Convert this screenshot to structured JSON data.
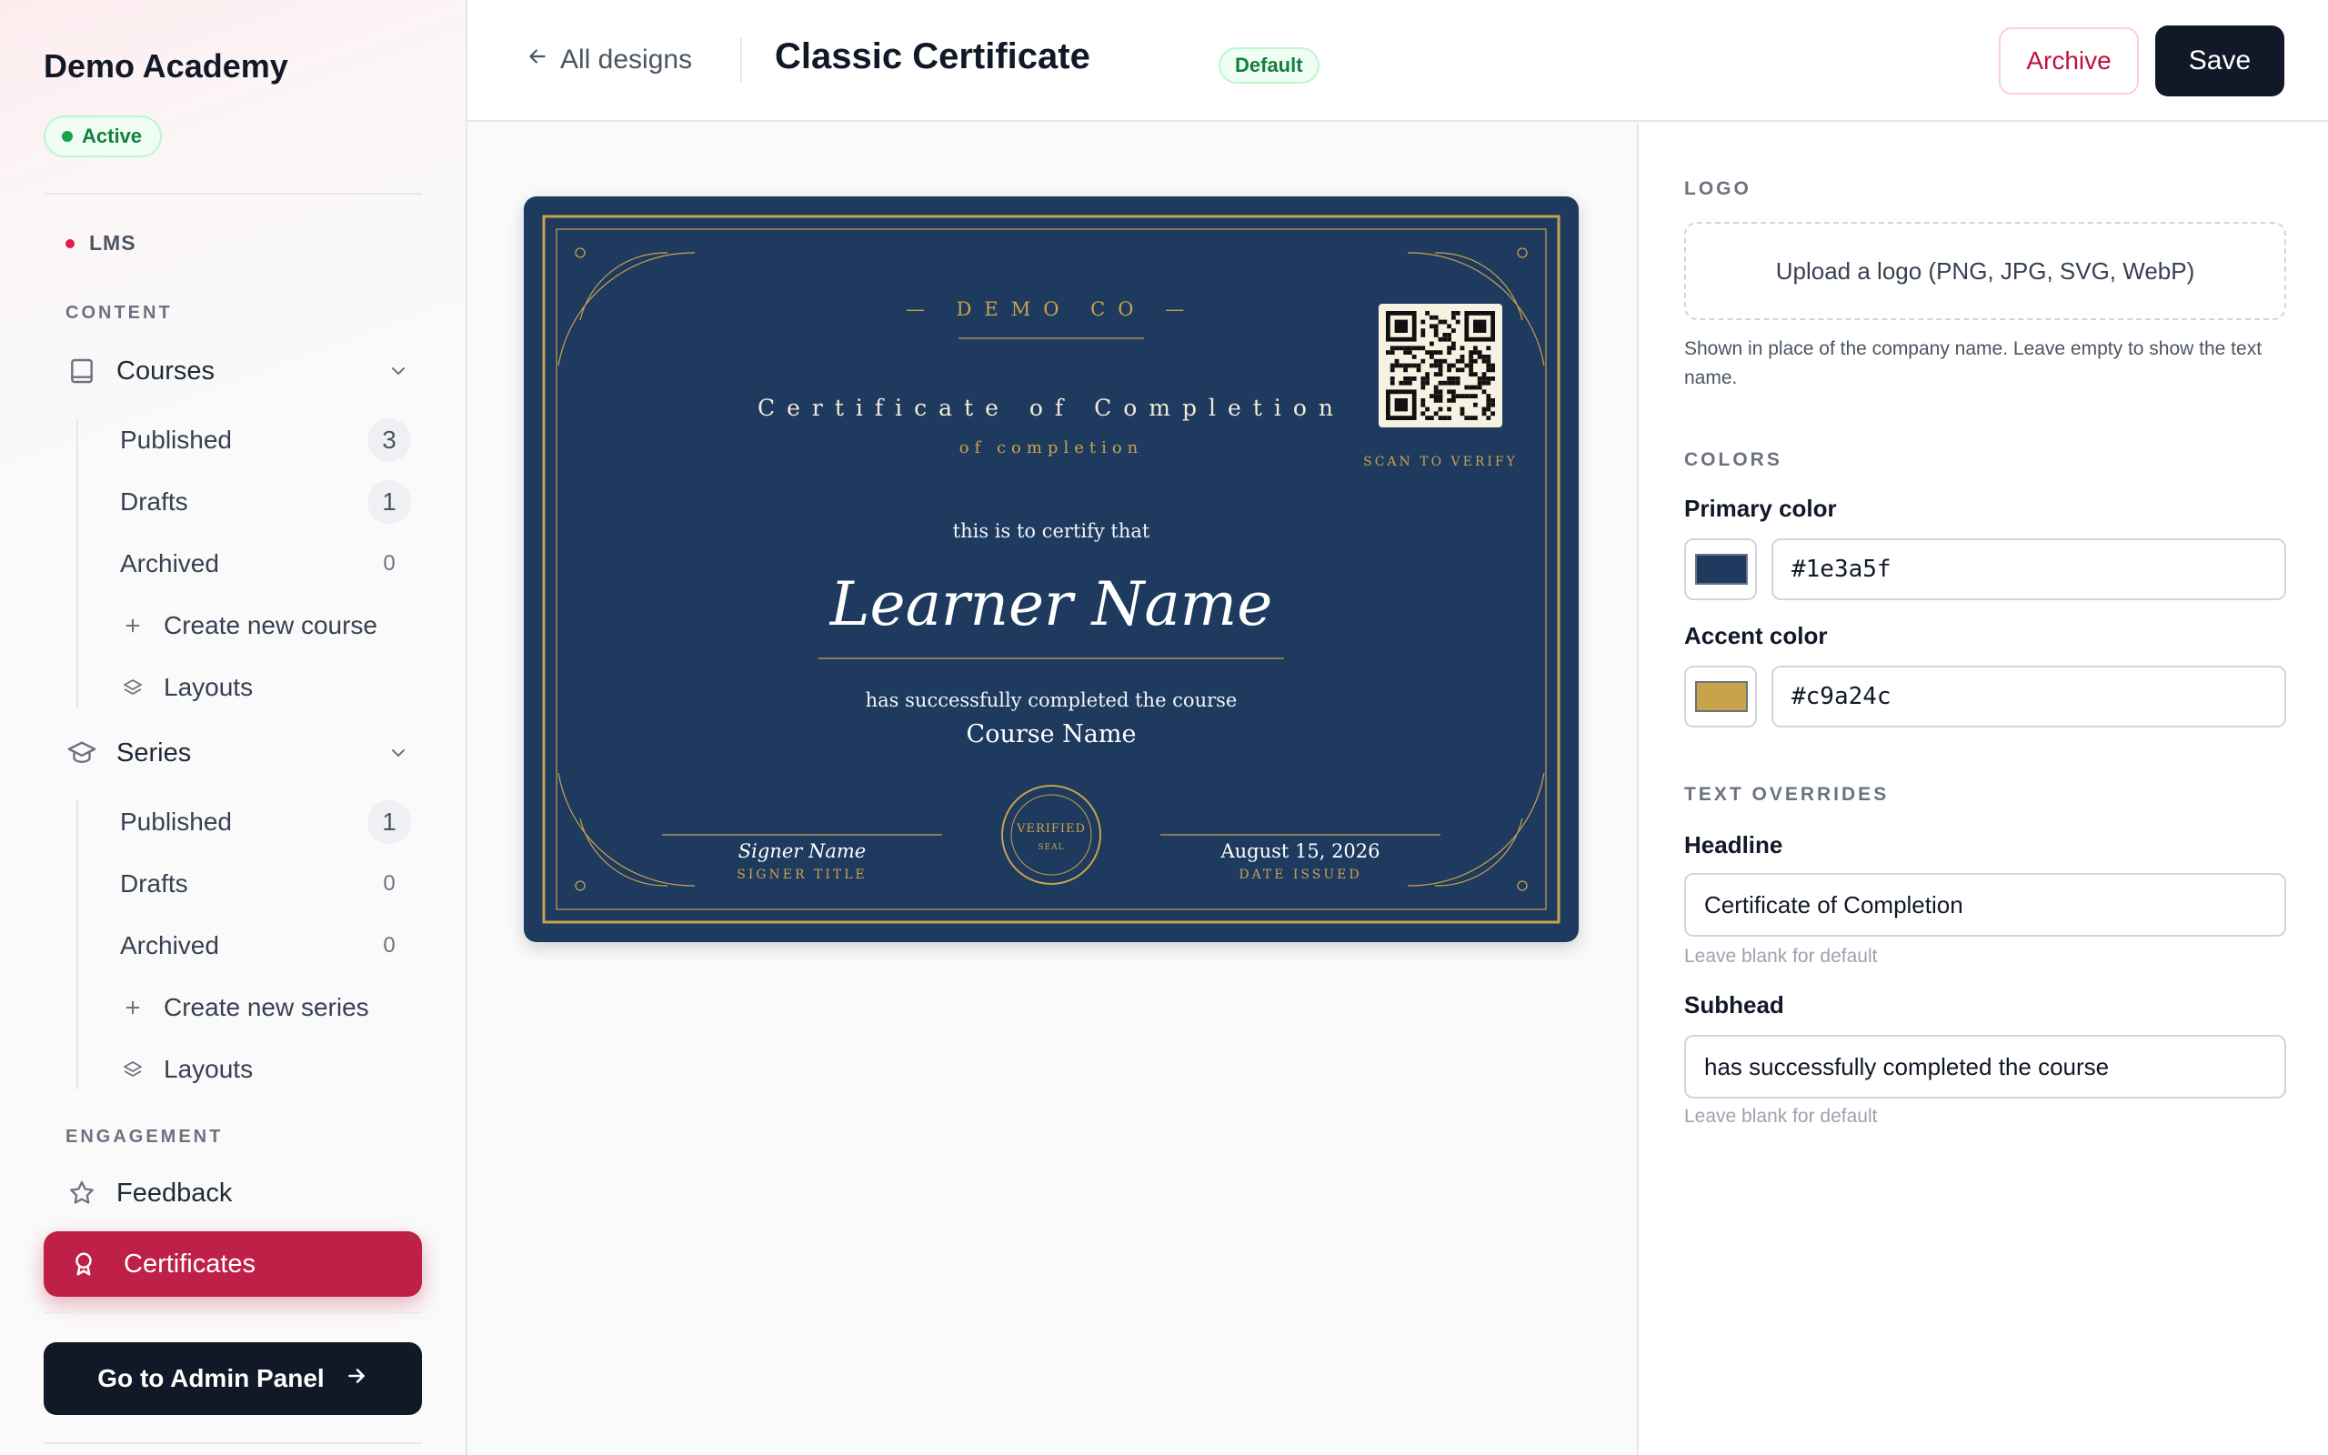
{
  "sidebar": {
    "brand": "Demo Academy",
    "status": "Active",
    "section_root": "LMS",
    "content_label": "CONTENT",
    "courses": {
      "label": "Courses",
      "items": [
        {
          "label": "Published",
          "count": "3"
        },
        {
          "label": "Drafts",
          "count": "1"
        },
        {
          "label": "Archived",
          "count": "0"
        }
      ],
      "create": "Create new course",
      "layouts": "Layouts"
    },
    "series": {
      "label": "Series",
      "items": [
        {
          "label": "Published",
          "count": "1"
        },
        {
          "label": "Drafts",
          "count": "0"
        },
        {
          "label": "Archived",
          "count": "0"
        }
      ],
      "create": "Create new series",
      "layouts": "Layouts"
    },
    "engagement_label": "ENGAGEMENT",
    "feedback": "Feedback",
    "certificates": "Certificates",
    "admin_button": "Go to Admin Panel"
  },
  "header": {
    "back": "All designs",
    "title": "Classic Certificate",
    "badge": "Default",
    "archive": "Archive",
    "save": "Save"
  },
  "certificate": {
    "company": "— DEMO CO —",
    "headline": "Certificate of Completion",
    "subline": "of completion",
    "certify": "this is to certify that",
    "learner": "Learner Name",
    "completed": "has successfully completed the course",
    "course": "Course Name",
    "signer_name": "Signer Name",
    "signer_title": "SIGNER TITLE",
    "date": "August 15, 2026",
    "date_label": "DATE ISSUED",
    "scan": "SCAN TO VERIFY",
    "seal_top": "VERIFIED",
    "seal_bottom": "SEAL"
  },
  "panel": {
    "logo_label": "LOGO",
    "upload": "Upload a logo (PNG, JPG, SVG, WebP)",
    "logo_help": "Shown in place of the company name. Leave empty to show the text name.",
    "colors_label": "COLORS",
    "primary_label": "Primary color",
    "primary_value": "#1e3a5f",
    "accent_label": "Accent color",
    "accent_value": "#c9a24c",
    "overrides_label": "TEXT OVERRIDES",
    "headline_label": "Headline",
    "headline_value": "Certificate of Completion",
    "headline_hint": "Leave blank for default",
    "subhead_label": "Subhead",
    "subhead_value": "has successfully completed the course",
    "subhead_hint": "Leave blank for default"
  },
  "colors": {
    "accent_brand": "#be2047",
    "primary": "#1e3a5f",
    "accent": "#c9a24c"
  },
  "icons": {
    "courses": "book-icon",
    "series": "graduation-cap-icon",
    "feedback": "star-icon",
    "certificates": "award-icon",
    "create": "plus-icon",
    "layouts": "layers-icon",
    "back": "arrow-left-icon",
    "admin": "arrow-right-icon"
  }
}
